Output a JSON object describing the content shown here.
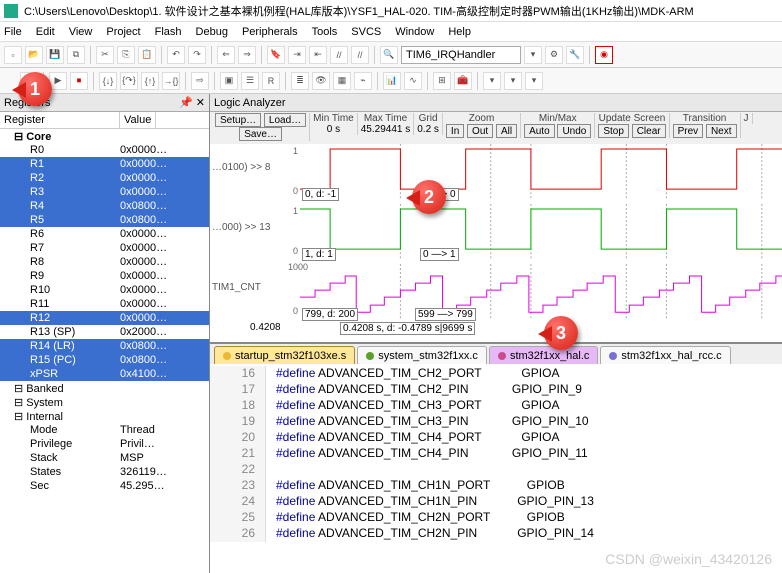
{
  "title": "C:\\Users\\Lenovo\\Desktop\\1. 软件设计之基本裸机例程(HAL库版本)\\YSF1_HAL-020. TIM-高级控制定时器PWM输出(1KHz输出)\\MDK-ARM",
  "menu": [
    "File",
    "Edit",
    "View",
    "Project",
    "Flash",
    "Debug",
    "Peripherals",
    "Tools",
    "SVCS",
    "Window",
    "Help"
  ],
  "combo_fn": "TIM6_IRQHandler",
  "pane_registers": "Registers",
  "pane_logic": "Logic Analyzer",
  "reg_cols": {
    "name": "Register",
    "value": "Value"
  },
  "regs": [
    {
      "n": "Core",
      "v": "",
      "cls": "root"
    },
    {
      "n": "R0",
      "v": "0x0000…",
      "cls": ""
    },
    {
      "n": "R1",
      "v": "0x0000…",
      "cls": "sel"
    },
    {
      "n": "R2",
      "v": "0x0000…",
      "cls": "sel"
    },
    {
      "n": "R3",
      "v": "0x0000…",
      "cls": "sel"
    },
    {
      "n": "R4",
      "v": "0x0800…",
      "cls": "sel"
    },
    {
      "n": "R5",
      "v": "0x0800…",
      "cls": "sel"
    },
    {
      "n": "R6",
      "v": "0x0000…",
      "cls": ""
    },
    {
      "n": "R7",
      "v": "0x0000…",
      "cls": ""
    },
    {
      "n": "R8",
      "v": "0x0000…",
      "cls": ""
    },
    {
      "n": "R9",
      "v": "0x0000…",
      "cls": ""
    },
    {
      "n": "R10",
      "v": "0x0000…",
      "cls": ""
    },
    {
      "n": "R11",
      "v": "0x0000…",
      "cls": ""
    },
    {
      "n": "R12",
      "v": "0x0000…",
      "cls": "sel"
    },
    {
      "n": "R13 (SP)",
      "v": "0x2000…",
      "cls": ""
    },
    {
      "n": "R14 (LR)",
      "v": "0x0800…",
      "cls": "sel"
    },
    {
      "n": "R15 (PC)",
      "v": "0x0800…",
      "cls": "sel"
    },
    {
      "n": "xPSR",
      "v": "0x4100…",
      "cls": "sel"
    },
    {
      "n": "Banked",
      "v": "",
      "cls": "node"
    },
    {
      "n": "System",
      "v": "",
      "cls": "node"
    },
    {
      "n": "Internal",
      "v": "",
      "cls": "node"
    },
    {
      "n": "Mode",
      "v": "Thread",
      "cls": ""
    },
    {
      "n": "Privilege",
      "v": "Privil…",
      "cls": ""
    },
    {
      "n": "Stack",
      "v": "MSP",
      "cls": ""
    },
    {
      "n": "States",
      "v": "326119…",
      "cls": ""
    },
    {
      "n": "Sec",
      "v": "45.295…",
      "cls": ""
    }
  ],
  "la": {
    "setup": "Setup…",
    "load": "Load…",
    "save": "Save…",
    "min_time_l": "Min Time",
    "min_time": "0 s",
    "max_time_l": "Max Time",
    "max_time": "45.29441 s",
    "grid_l": "Grid",
    "grid": "0.2 s",
    "zoom_l": "Zoom",
    "zoom_in": "In",
    "zoom_out": "Out",
    "zoom_all": "All",
    "minmax_l": "Min/Max",
    "auto": "Auto",
    "undo": "Undo",
    "upd_l": "Update Screen",
    "stop": "Stop",
    "clear": "Clear",
    "tr_l": "Transition",
    "prev": "Prev",
    "next": "Next",
    "j": "J"
  },
  "sig1_label": "…0100) >> 8",
  "sig2_label": "…000) >> 13",
  "sig3_label": "TIM1_CNT",
  "sig3_max": "1000",
  "box1": "0,   d: -1",
  "box2": "1 —> 0",
  "box3": "1,   d: 1",
  "box4": "0 —> 1",
  "box5": "799,  d: 200",
  "box6": "599 —> 799",
  "timebar_val": "0.4208",
  "timebar_txt": "0.4208 s,   d: -0.4789 s|9699 s",
  "tabs": [
    {
      "label": "startup_stm32f103xe.s",
      "active": true,
      "color": "#ecb731"
    },
    {
      "label": "system_stm32f1xx.c",
      "active": false,
      "color": "#5aa02c"
    },
    {
      "label": "stm32f1xx_hal.c",
      "active": false,
      "color": "#c94b8c",
      "sel": true
    },
    {
      "label": "stm32f1xx_hal_rcc.c",
      "active": false,
      "color": "#7a6fd1"
    }
  ],
  "code": [
    {
      "ln": "16",
      "t": "#define ADVANCED_TIM_CH2_PORT            GPIOA"
    },
    {
      "ln": "17",
      "t": "#define ADVANCED_TIM_CH2_PIN             GPIO_PIN_9"
    },
    {
      "ln": "18",
      "t": "#define ADVANCED_TIM_CH3_PORT            GPIOA"
    },
    {
      "ln": "19",
      "t": "#define ADVANCED_TIM_CH3_PIN             GPIO_PIN_10"
    },
    {
      "ln": "20",
      "t": "#define ADVANCED_TIM_CH4_PORT            GPIOA"
    },
    {
      "ln": "21",
      "t": "#define ADVANCED_TIM_CH4_PIN             GPIO_PIN_11"
    },
    {
      "ln": "22",
      "t": ""
    },
    {
      "ln": "23",
      "t": "#define ADVANCED_TIM_CH1N_PORT           GPIOB"
    },
    {
      "ln": "24",
      "t": "#define ADVANCED_TIM_CH1N_PIN            GPIO_PIN_13"
    },
    {
      "ln": "25",
      "t": "#define ADVANCED_TIM_CH2N_PORT           GPIOB"
    },
    {
      "ln": "26",
      "t": "#define ADVANCED_TIM_CH2N_PIN            GPIO_PIN_14"
    }
  ],
  "callouts": {
    "c1": "1",
    "c2": "2",
    "c3": "3"
  },
  "watermark": "CSDN @weixin_43420126"
}
